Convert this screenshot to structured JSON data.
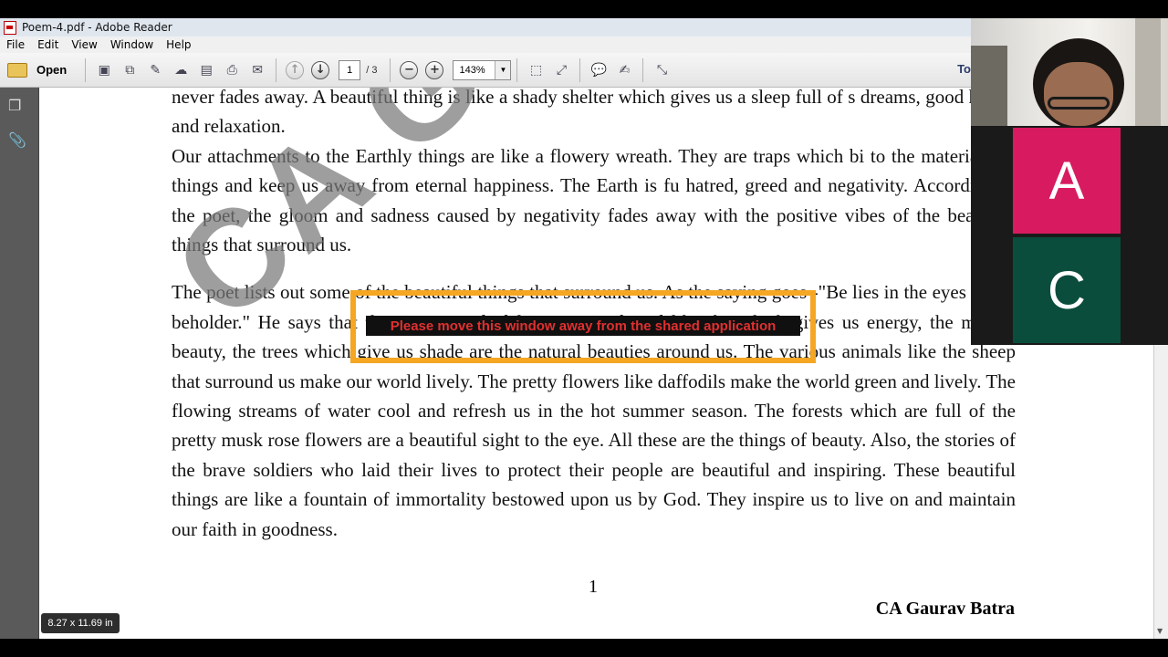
{
  "window": {
    "title": "Poem-4.pdf - Adobe Reader"
  },
  "menu": [
    "File",
    "Edit",
    "View",
    "Window",
    "Help"
  ],
  "toolbar": {
    "open_label": "Open",
    "page_current": "1",
    "page_total": "/ 3",
    "zoom": "143%",
    "tools_label": "To"
  },
  "document": {
    "watermark": "CA GA",
    "paragraphs": [
      "never fades away. A beautiful thing is like a shady shelter which gives us a sleep full of s dreams, good health and relaxation.",
      "Our attachments to the Earthly things are like a flowery wreath. They are traps which bi to the materialistic things and keep us away from eternal happiness. The Earth is fu hatred, greed and negativity. According to the poet, the gloom and sadness caused by negativity fades away with the positive vibes of the beautiful things that surround us.",
      "The poet lists out some of the beautiful things that surround us. As the saying goes -\"Be lies in the eyes of the beholder.\" He says that these are wonderful creations of God like the which gives us energy, the moon's beauty, the trees which give us shade are the natural beauties around us. The various animals like the sheep that surround us make our world lively. The pretty flowers like daffodils make the world green and lively. The flowing streams of water cool and refresh us in the hot summer season. The forests which are full of the pretty musk rose flowers are a beautiful sight to the eye. All these are the things of beauty. Also, the stories of the brave soldiers who laid their lives to protect their people are beautiful and inspiring. These beautiful things are like a fountain of immortality bestowed upon us by God. They inspire us to live on and maintain our faith in goodness."
    ],
    "page_number": "1",
    "author": "CA Gaurav Batra"
  },
  "share_warning": "Please move this window away from the shared application",
  "page_size": "8.27 x 11.69 in",
  "participants": {
    "tiles": [
      {
        "initial": "A",
        "color": "#d81b60"
      },
      {
        "initial": "C",
        "color": "#0b4d3c"
      }
    ]
  }
}
